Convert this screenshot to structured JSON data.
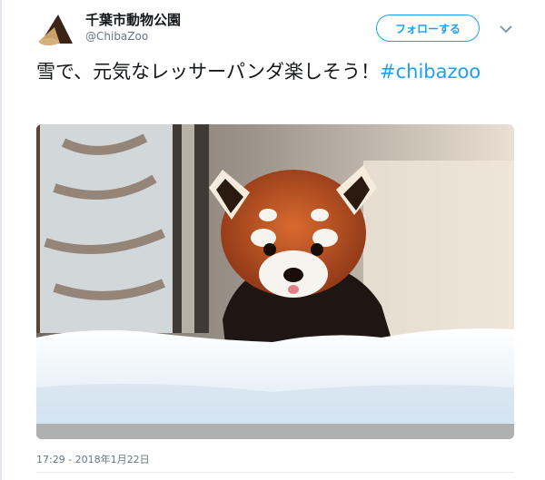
{
  "account": {
    "display_name": "千葉市動物公園",
    "handle": "@ChibaZoo"
  },
  "follow_button": {
    "label": "フォローする"
  },
  "more_menu": {
    "icon": "chevron-down-icon"
  },
  "tweet": {
    "text": "雪で、元気なレッサーパンダ楽しそう！",
    "hashtag": "#chibazoo",
    "timestamp": "17:29 - 2018年1月22日"
  },
  "colors": {
    "link": "#1da1f2",
    "text": "#14171a",
    "secondary": "#657786"
  },
  "media": {
    "subject": "red-panda-in-snow-photo"
  }
}
